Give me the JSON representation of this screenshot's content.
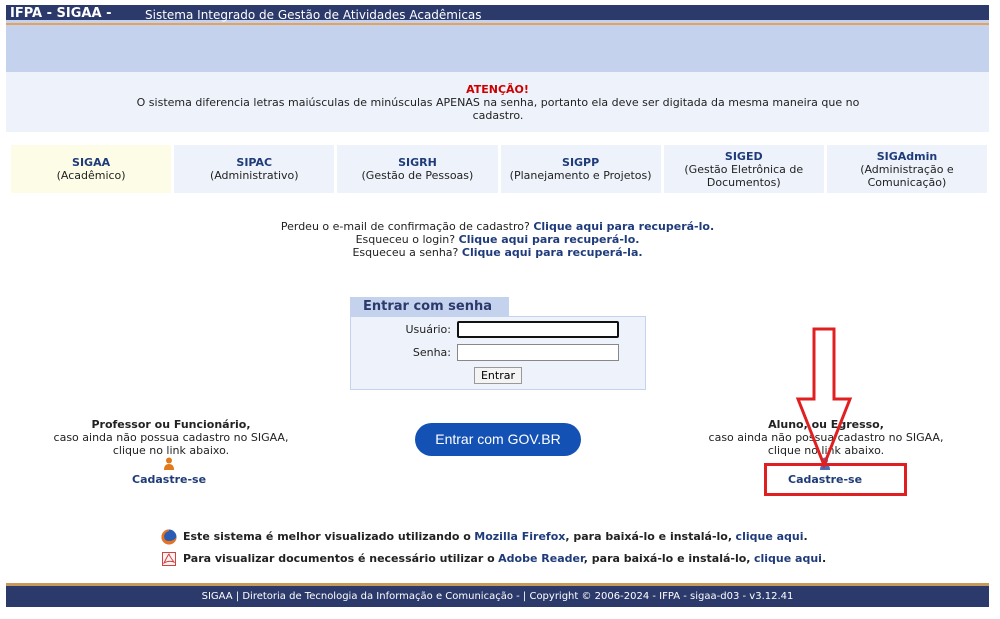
{
  "header": {
    "brand": "IFPA - SIGAA -",
    "subtitle": "Sistema Integrado de Gestão de Atividades Acadêmicas"
  },
  "notice": {
    "title": "ATENÇÃO!",
    "body": "O sistema diferencia letras maiúsculas de minúsculas APENAS na senha, portanto ela deve ser digitada da mesma maneira que no cadastro."
  },
  "systems": [
    {
      "name": "SIGAA",
      "desc": "(Acadêmico)"
    },
    {
      "name": "SIPAC",
      "desc": "(Administrativo)"
    },
    {
      "name": "SIGRH",
      "desc": "(Gestão de Pessoas)"
    },
    {
      "name": "SIGPP",
      "desc": "(Planejamento e Projetos)"
    },
    {
      "name": "SIGED",
      "desc": "(Gestão Eletrônica de Documentos)"
    },
    {
      "name": "SIGAdmin",
      "desc": "(Administração e Comunicação)"
    }
  ],
  "recover": {
    "email_text": "Perdeu o e-mail de confirmação de cadastro?",
    "email_link": "Clique aqui para recuperá-lo.",
    "login_text": "Esqueceu o login?",
    "login_link": "Clique aqui para recuperá-lo.",
    "password_text": "Esqueceu a senha?",
    "password_link": "Clique aqui para recuperá-la."
  },
  "login": {
    "tab_label": "Entrar com senha",
    "user_label": "Usuário:",
    "user_value": "",
    "password_label": "Senha:",
    "password_value": "",
    "submit_label": "Entrar"
  },
  "staff": {
    "heading": "Professor ou Funcionário,",
    "line1": "caso ainda não possua cadastro no SIGAA,",
    "line2": "clique no link abaixo.",
    "link": "Cadastre-se"
  },
  "govbr_button": "Entrar com GOV.BR",
  "student": {
    "heading": "Aluno, ou Egresso,",
    "line1": "caso ainda não possua cadastro no SIGAA,",
    "line2": "clique no link abaixo.",
    "link": "Cadastre-se"
  },
  "tips": {
    "firefox_prefix": "Este sistema é melhor visualizado utilizando o",
    "firefox_name": "Mozilla Firefox",
    "firefox_middle": ", para baixá-lo e instalá-lo,",
    "firefox_link": "clique aqui",
    "reader_prefix": "Para visualizar documentos é necessário utilizar o",
    "reader_name": "Adobe Reader",
    "reader_middle": ", para baixá-lo e instalá-lo,",
    "reader_link": "clique aqui"
  },
  "footer": "SIGAA | Diretoria de Tecnologia da Informação e Comunicação - | Copyright © 2006-2024 - IFPA - sigaa-d03 - v3.12.41",
  "colors": {
    "header_bg": "#2b3a6b",
    "band": "#c5d2ee",
    "link": "#1f3b7a",
    "alert": "#cc0000",
    "govbr": "#1351b4",
    "highlight": "#e02020"
  }
}
